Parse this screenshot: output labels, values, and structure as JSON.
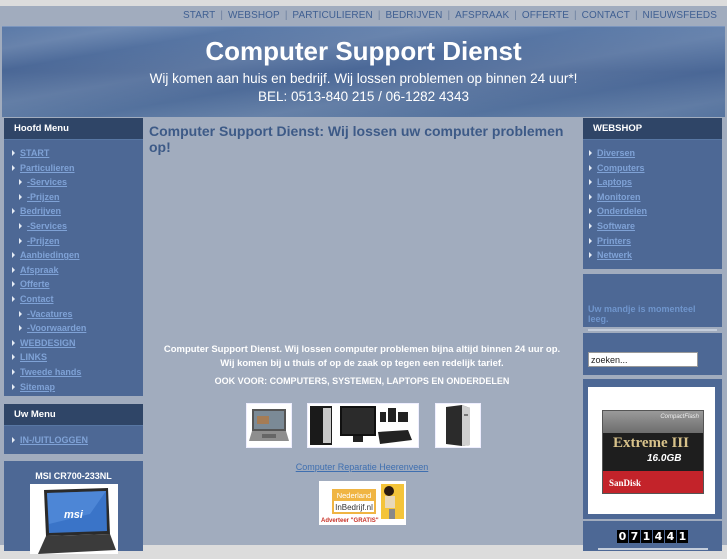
{
  "topnav": {
    "items": [
      "START",
      "WEBSHOP",
      "PARTICULIEREN",
      "BEDRIJVEN",
      "AFSPRAAK",
      "OFFERTE",
      "CONTACT",
      "NIEUWSFEEDS"
    ],
    "separator": "|"
  },
  "header": {
    "title": "Computer Support Dienst",
    "subtitle": "Wij komen aan huis en bedrijf. Wij lossen problemen op binnen 24 uur*!",
    "phone": "BEL: 0513-840 215 / 06-1282 4343"
  },
  "left": {
    "main_menu": {
      "title": "Hoofd Menu",
      "items": [
        {
          "label": "START",
          "sub": false
        },
        {
          "label": "Particulieren",
          "sub": false
        },
        {
          "label": "-Services",
          "sub": true
        },
        {
          "label": "-Prijzen",
          "sub": true
        },
        {
          "label": "Bedrijven",
          "sub": false
        },
        {
          "label": "-Services",
          "sub": true
        },
        {
          "label": "-Prijzen",
          "sub": true
        },
        {
          "label": "Aanbiedingen",
          "sub": false
        },
        {
          "label": "Afspraak",
          "sub": false
        },
        {
          "label": "Offerte",
          "sub": false
        },
        {
          "label": "Contact",
          "sub": false
        },
        {
          "label": "-Vacatures",
          "sub": true
        },
        {
          "label": "-Voorwaarden",
          "sub": true
        },
        {
          "label": "WEBDESIGN",
          "sub": false
        },
        {
          "label": "LINKS",
          "sub": false
        },
        {
          "label": "Tweede hands",
          "sub": false
        },
        {
          "label": "Sitemap",
          "sub": false
        }
      ]
    },
    "user_menu": {
      "title": "Uw Menu",
      "items": [
        {
          "label": "IN-/UITLOGGEN"
        }
      ]
    },
    "product": {
      "title": "MSI CR700-233NL",
      "image_brand": "msi"
    }
  },
  "center": {
    "heading": "Computer Support Dienst: Wij lossen uw computer problemen op!",
    "paragraph_line1": "Computer Support Dienst. Wij lossen computer problemen bijna altijd binnen 24 uur op.",
    "paragraph_line2": "Wij komen bij u thuis of op de zaak op tegen een redelijk tarief.",
    "also_for": "OOK VOOR: COMPUTERS, SYSTEMEN, LAPTOPS EN ONDERDELEN",
    "link": "Computer Reparatie Heerenveen",
    "banner": {
      "line1": "Nederland",
      "line2": "InBedrijf.nl",
      "line3": "Adverteer \"GRATIS\""
    }
  },
  "right": {
    "webshop": {
      "title": "WEBSHOP",
      "items": [
        "Diversen",
        "Computers",
        "Laptops",
        "Monitoren",
        "Onderdelen",
        "Software",
        "Printers",
        "Netwerk"
      ]
    },
    "cart_text": "Uw mandje is momenteel leeg.",
    "search": {
      "value": "zoeken..."
    },
    "promo": {
      "brand_top": "CompactFlash",
      "brand_small": "SanDisk",
      "product": "Extreme III",
      "capacity": "16.0GB",
      "brand_bottom": "SanDisk"
    },
    "counter": [
      "0",
      "7",
      "1",
      "4",
      "4",
      "1"
    ]
  }
}
